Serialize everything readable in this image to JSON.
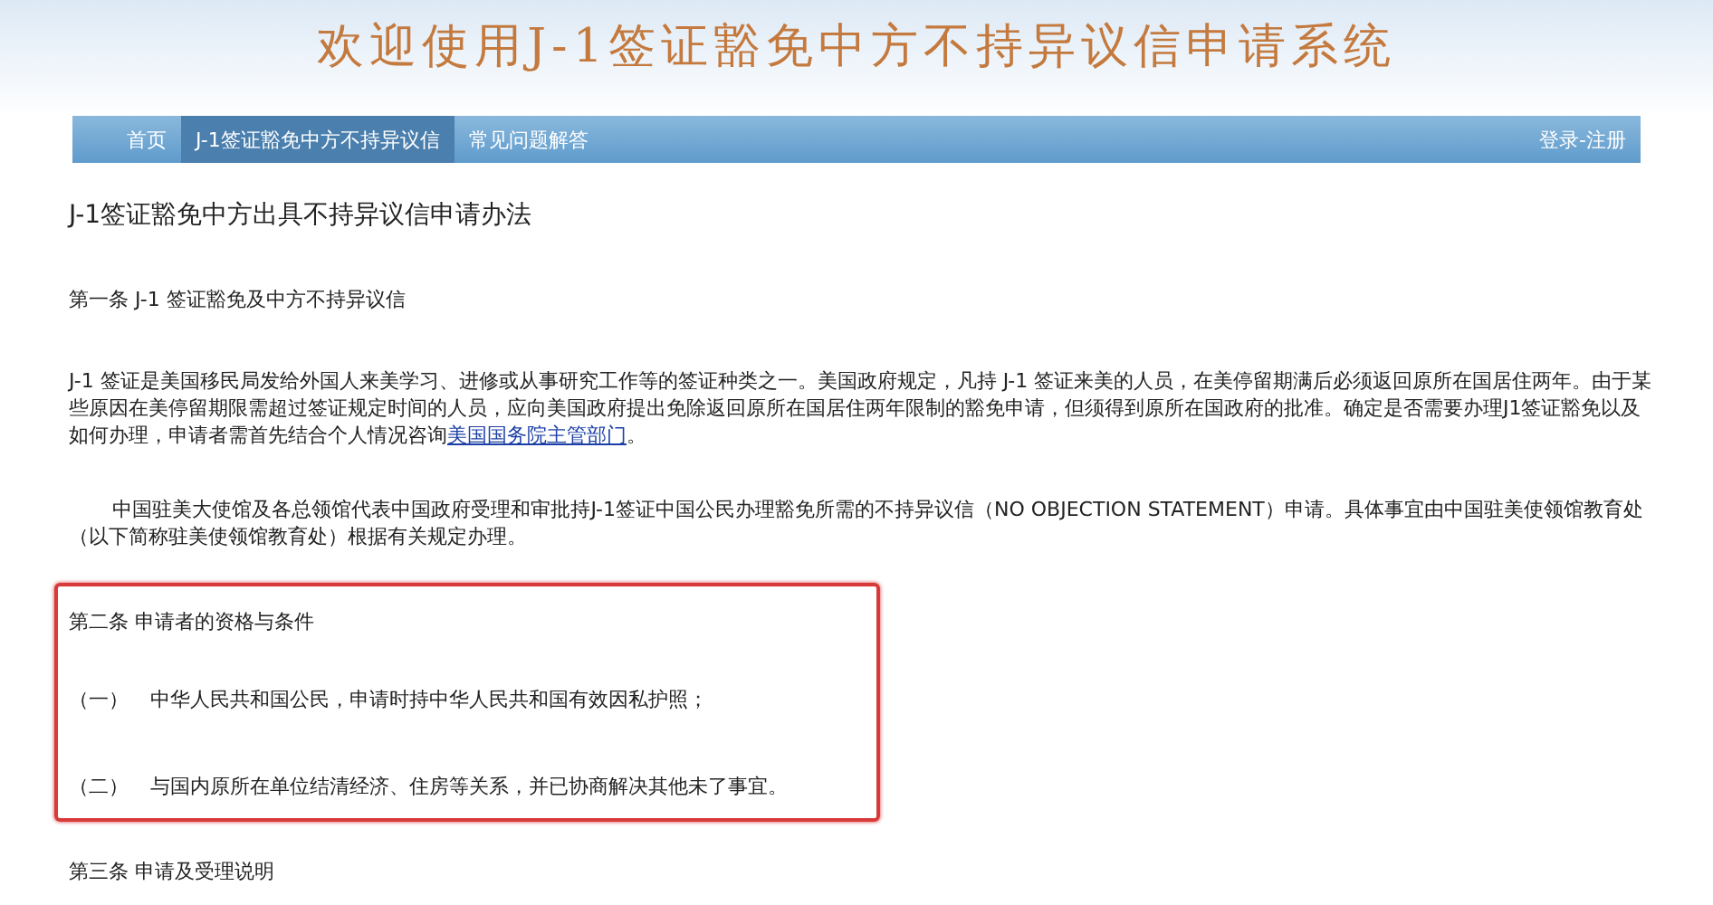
{
  "header": {
    "title": "欢迎使用J-1签证豁免中方不持异议信申请系统"
  },
  "nav": {
    "items": [
      {
        "label": "首页",
        "selected": false
      },
      {
        "label": "J-1签证豁免中方不持异议信",
        "selected": true
      },
      {
        "label": "常见问题解答",
        "selected": false
      }
    ],
    "account_link": "登录-注册"
  },
  "article": {
    "title": "J-1签证豁免中方出具不持异议信申请办法",
    "sections": [
      {
        "heading": "第一条 J-1 签证豁免及中方不持异议信",
        "highlighted": false,
        "paragraphs": [
          {
            "kind": "text",
            "text": "J-1 签证是美国移民局发给外国人来美学习、进修或从事研究工作等的签证种类之一。美国政府规定，凡持 J-1 签证来美的人员，在美停留期满后必须返回原所在国居住两年。由于某些原因在美停留期限需超过签证规定时间的人员，应向美国政府提出免除返回原所在国居住两年限制的豁免申请，但须得到原所在国政府的批准。确定是否需要办理J1签证豁免以及如何办理，申请者需首先结合个人情况咨询",
            "link": "美国国务院主管部门",
            "tail": "。"
          },
          {
            "kind": "indented",
            "text": "中国驻美大使馆及各总领馆代表中国政府受理和审批持J-1签证中国公民办理豁免所需的不持异议信（NO OBJECTION STATEMENT）申请。具体事宜由中国驻美使领馆教育处（以下简称驻美使领馆教育处）根据有关规定办理。"
          }
        ]
      },
      {
        "heading": "第二条 申请者的资格与条件",
        "highlighted": true,
        "paragraphs": [
          {
            "kind": "item",
            "marker": "（一）",
            "text": "中华人民共和国公民，申请时持中华人民共和国有效因私护照；"
          },
          {
            "kind": "item",
            "marker": "（二）",
            "text": "与国内原所在单位结清经济、住房等关系，并已协商解决其他未了事宜。"
          }
        ]
      },
      {
        "heading": "第三条 申请及受理说明",
        "highlighted": false
      }
    ]
  }
}
